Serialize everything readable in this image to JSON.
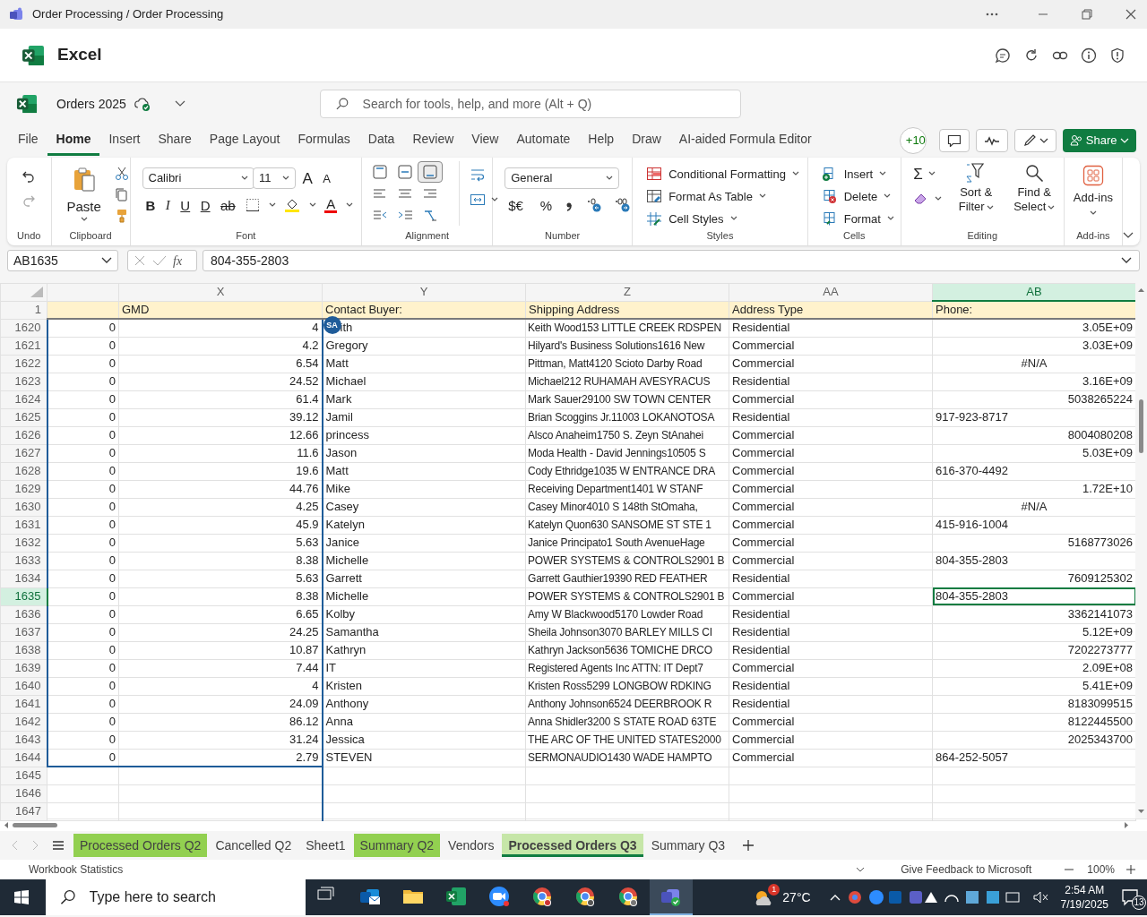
{
  "window": {
    "title": "Order Processing / Order Processing"
  },
  "app": {
    "name": "Excel"
  },
  "workbook": {
    "name": "Orders 2025",
    "search_placeholder": "Search for tools, help, and more (Alt + Q)"
  },
  "menu_tabs": [
    {
      "label": "File",
      "selected": false
    },
    {
      "label": "Home",
      "selected": true
    },
    {
      "label": "Insert",
      "selected": false
    },
    {
      "label": "Share",
      "selected": false
    },
    {
      "label": "Page Layout",
      "selected": false
    },
    {
      "label": "Formulas",
      "selected": false
    },
    {
      "label": "Data",
      "selected": false
    },
    {
      "label": "Review",
      "selected": false
    },
    {
      "label": "View",
      "selected": false
    },
    {
      "label": "Automate",
      "selected": false
    },
    {
      "label": "Help",
      "selected": false
    },
    {
      "label": "Draw",
      "selected": false
    },
    {
      "label": "AI-aided Formula Editor",
      "selected": false
    }
  ],
  "collaborators": "+10",
  "share_button": "Share",
  "ribbon": {
    "undo": {
      "label": "Undo"
    },
    "clipboard": {
      "paste": "Paste",
      "label": "Clipboard"
    },
    "font": {
      "family": "Calibri",
      "size": "11",
      "grow": "A",
      "shrink": "A",
      "styles": [
        "B",
        "I",
        "U",
        "D",
        "ab"
      ],
      "color_letter": "A",
      "label": "Font"
    },
    "alignment": {
      "label": "Alignment"
    },
    "number": {
      "format": "General",
      "currency": "$€",
      "percent": "%",
      "label": "Number"
    },
    "styles": {
      "items": [
        "Conditional Formatting",
        "Format As Table",
        "Cell Styles"
      ],
      "label": "Styles"
    },
    "cells": {
      "items": [
        "Insert",
        "Delete",
        "Format"
      ],
      "label": "Cells"
    },
    "editing": {
      "sum": "Σ",
      "sort": "Sort & Filter",
      "find": "Find & Select",
      "label": "Editing"
    },
    "addins": {
      "button": "Add-ins",
      "label": "Add-ins"
    }
  },
  "formula_bar": {
    "name_box": "AB1635",
    "fx": "fx",
    "value": "804-355-2803"
  },
  "sheet": {
    "columns": [
      {
        "selected": false
      },
      {
        "letter": "X",
        "heading": "GMD",
        "selected": false
      },
      {
        "letter": "Y",
        "heading": "Contact Buyer:",
        "selected": false
      },
      {
        "letter": "Z",
        "heading": "Shipping Address",
        "selected": false
      },
      {
        "letter": "AA",
        "heading": "Address Type",
        "selected": false
      },
      {
        "letter": "AB",
        "heading": "Phone:",
        "selected": true
      }
    ],
    "header_row_number": "1",
    "collaborator": {
      "initials": "SA"
    },
    "rows": [
      {
        "number": "1620",
        "selected": false,
        "values": [
          "0",
          "4",
          "ith",
          "Keith Wood153 LITTLE CREEK RDSPEN",
          "Residential"
        ],
        "phone": {
          "text": "3.05E+09",
          "kind": "number"
        }
      },
      {
        "number": "1621",
        "selected": false,
        "values": [
          "0",
          "4.2",
          "Gregory",
          "Hilyard's Business Solutions1616 New",
          "Commercial"
        ],
        "phone": {
          "text": "3.03E+09",
          "kind": "number"
        }
      },
      {
        "number": "1622",
        "selected": false,
        "values": [
          "0",
          "6.54",
          "Matt",
          "Pittman, Matt4120 Scioto Darby Road",
          "Commercial"
        ],
        "phone": {
          "text": "#N/A",
          "kind": "error"
        }
      },
      {
        "number": "1623",
        "selected": false,
        "values": [
          "0",
          "24.52",
          "Michael",
          "Michael212 RUHAMAH AVESYRACUS",
          "Residential"
        ],
        "phone": {
          "text": "3.16E+09",
          "kind": "number"
        }
      },
      {
        "number": "1624",
        "selected": false,
        "values": [
          "0",
          "61.4",
          "Mark",
          "Mark Sauer29100 SW TOWN CENTER",
          "Commercial"
        ],
        "phone": {
          "text": "5038265224",
          "kind": "number"
        }
      },
      {
        "number": "1625",
        "selected": false,
        "values": [
          "0",
          "39.12",
          "Jamil",
          "Brian Scoggins Jr.11003 LOKANOTOSA",
          "Residential"
        ],
        "phone": {
          "text": "917-923-8717",
          "kind": "text"
        }
      },
      {
        "number": "1626",
        "selected": false,
        "values": [
          "0",
          "12.66",
          "princess",
          "Alsco Anaheim1750 S. Zeyn StAnahei",
          "Commercial"
        ],
        "phone": {
          "text": "8004080208",
          "kind": "number"
        }
      },
      {
        "number": "1627",
        "selected": false,
        "values": [
          "0",
          "11.6",
          "Jason",
          "Moda Health - David Jennings10505 S",
          "Commercial"
        ],
        "phone": {
          "text": "5.03E+09",
          "kind": "number"
        }
      },
      {
        "number": "1628",
        "selected": false,
        "values": [
          "0",
          "19.6",
          "Matt",
          "Cody Ethridge1035 W ENTRANCE DRA",
          "Commercial"
        ],
        "phone": {
          "text": "616-370-4492",
          "kind": "text"
        }
      },
      {
        "number": "1629",
        "selected": false,
        "values": [
          "0",
          "44.76",
          "Mike",
          "Receiving Department1401 W STANF",
          "Commercial"
        ],
        "phone": {
          "text": "1.72E+10",
          "kind": "number"
        }
      },
      {
        "number": "1630",
        "selected": false,
        "values": [
          "0",
          "4.25",
          "Casey",
          "Casey Minor4010 S 148th StOmaha,",
          "Commercial"
        ],
        "phone": {
          "text": "#N/A",
          "kind": "error"
        }
      },
      {
        "number": "1631",
        "selected": false,
        "values": [
          "0",
          "45.9",
          "Katelyn",
          "Katelyn Quon630 SANSOME ST STE 1",
          "Commercial"
        ],
        "phone": {
          "text": "415-916-1004",
          "kind": "text"
        }
      },
      {
        "number": "1632",
        "selected": false,
        "values": [
          "0",
          "5.63",
          "Janice",
          "Janice Principato1 South AvenueHage",
          "Commercial"
        ],
        "phone": {
          "text": "5168773026",
          "kind": "number"
        }
      },
      {
        "number": "1633",
        "selected": false,
        "values": [
          "0",
          "8.38",
          "Michelle",
          "POWER SYSTEMS & CONTROLS2901 B",
          "Commercial"
        ],
        "phone": {
          "text": "804-355-2803",
          "kind": "text"
        }
      },
      {
        "number": "1634",
        "selected": false,
        "values": [
          "0",
          "5.63",
          "Garrett",
          "Garrett Gauthier19390 RED FEATHER",
          "Residential"
        ],
        "phone": {
          "text": "7609125302",
          "kind": "number"
        }
      },
      {
        "number": "1635",
        "selected": true,
        "values": [
          "0",
          "8.38",
          "Michelle",
          "POWER SYSTEMS & CONTROLS2901 B",
          "Commercial"
        ],
        "phone": {
          "text": "804-355-2803",
          "kind": "text"
        }
      },
      {
        "number": "1636",
        "selected": false,
        "values": [
          "0",
          "6.65",
          "Kolby",
          "Amy W Blackwood5170 Lowder Road",
          "Residential"
        ],
        "phone": {
          "text": "3362141073",
          "kind": "number"
        }
      },
      {
        "number": "1637",
        "selected": false,
        "values": [
          "0",
          "24.25",
          "Samantha",
          "Sheila Johnson3070 BARLEY MILLS CI",
          "Residential"
        ],
        "phone": {
          "text": "5.12E+09",
          "kind": "number"
        }
      },
      {
        "number": "1638",
        "selected": false,
        "values": [
          "0",
          "10.87",
          "Kathryn",
          "Kathryn Jackson5636 TOMICHE DRCO",
          "Residential"
        ],
        "phone": {
          "text": "7202273777",
          "kind": "number"
        }
      },
      {
        "number": "1639",
        "selected": false,
        "values": [
          "0",
          "7.44",
          "IT",
          "Registered Agents Inc ATTN: IT Dept7",
          "Commercial"
        ],
        "phone": {
          "text": "2.09E+08",
          "kind": "number"
        }
      },
      {
        "number": "1640",
        "selected": false,
        "values": [
          "0",
          "4",
          "Kristen",
          "Kristen Ross5299 LONGBOW RDKING",
          "Residential"
        ],
        "phone": {
          "text": "5.41E+09",
          "kind": "number"
        }
      },
      {
        "number": "1641",
        "selected": false,
        "values": [
          "0",
          "24.09",
          "Anthony",
          "Anthony Johnson6524 DEERBROOK R",
          "Residential"
        ],
        "phone": {
          "text": "8183099515",
          "kind": "number"
        }
      },
      {
        "number": "1642",
        "selected": false,
        "values": [
          "0",
          "86.12",
          "Anna",
          "Anna Shidler3200 S STATE ROAD 63TE",
          "Commercial"
        ],
        "phone": {
          "text": "8122445500",
          "kind": "number"
        }
      },
      {
        "number": "1643",
        "selected": false,
        "values": [
          "0",
          "31.24",
          "Jessica",
          "THE ARC OF THE UNITED STATES2000",
          "Commercial"
        ],
        "phone": {
          "text": "2025343700",
          "kind": "number"
        }
      },
      {
        "number": "1644",
        "selected": false,
        "values": [
          "0",
          "2.79",
          "STEVEN",
          "SERMONAUDIO1430 WADE HAMPTO",
          "Commercial"
        ],
        "phone": {
          "text": "864-252-5057",
          "kind": "text"
        }
      },
      {
        "number": "1645",
        "selected": false
      },
      {
        "number": "1646",
        "selected": false
      },
      {
        "number": "1647",
        "selected": false
      }
    ]
  },
  "sheet_tabs": [
    {
      "label": "Processed Orders Q2",
      "selected": false,
      "color": "#92d050"
    },
    {
      "label": "Cancelled Q2",
      "selected": false
    },
    {
      "label": "Sheet1",
      "selected": false
    },
    {
      "label": "Summary Q2",
      "selected": false,
      "color": "#92d050"
    },
    {
      "label": "Vendors",
      "selected": false
    },
    {
      "label": "Processed Orders Q3",
      "selected": true,
      "color": "#c6e6a8"
    },
    {
      "label": "Summary Q3",
      "selected": false
    }
  ],
  "status_bar": {
    "left": "Workbook Statistics",
    "feedback": "Give Feedback to Microsoft",
    "zoom": "100%"
  },
  "taskbar": {
    "search_placeholder": "Type here to search",
    "weather_badge": "1",
    "temperature": "27°C",
    "time": "2:54 AM",
    "date": "7/19/2025",
    "notifications": "13"
  }
}
